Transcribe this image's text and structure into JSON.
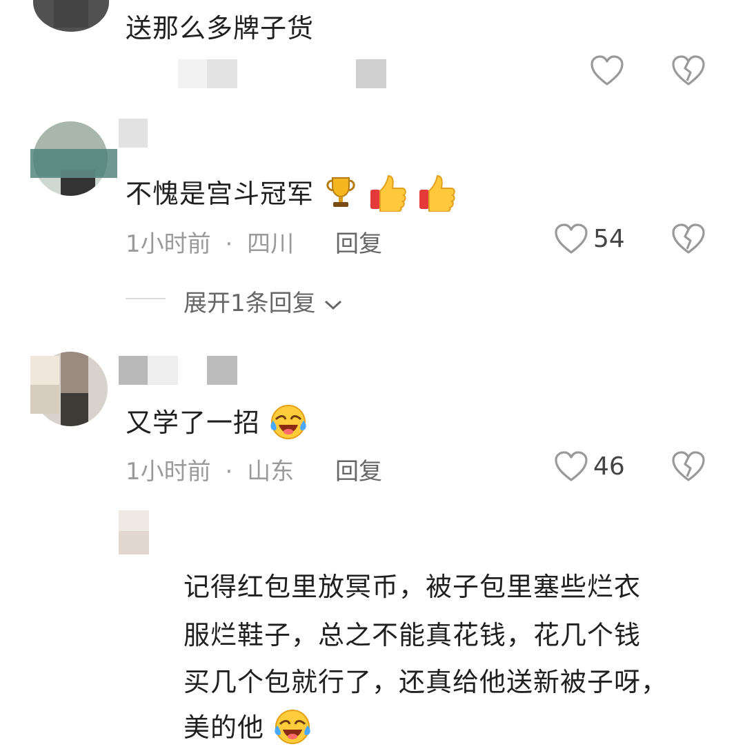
{
  "comments": [
    {
      "text": "送那么多牌子货"
    },
    {
      "text": "不愧是宫斗冠军",
      "emoji": [
        "trophy-emoji",
        "thumbs-up-emoji",
        "thumbs-up-emoji"
      ],
      "time": "1小时前",
      "location": "四川",
      "sep": "·",
      "reply_label": "回复",
      "likes": "54",
      "expand_label": "展开1条回复"
    },
    {
      "text": "又学了一招",
      "emoji": [
        "laughing-crying-emoji"
      ],
      "time": "1小时前",
      "location": "山东",
      "sep": "·",
      "reply_label": "回复",
      "likes": "46"
    }
  ],
  "reply": {
    "lines": [
      "记得红包里放冥币，被子包里塞些烂衣",
      "服烂鞋子，总之不能真花钱，花几个钱",
      "买几个包就行了，还真给他送新被子呀，",
      "美的他"
    ],
    "emoji": [
      "laughing-crying-emoji"
    ]
  },
  "colors": {
    "text": "#1f1f1f",
    "meta": "#9a9a9a",
    "icon": "#999999"
  }
}
